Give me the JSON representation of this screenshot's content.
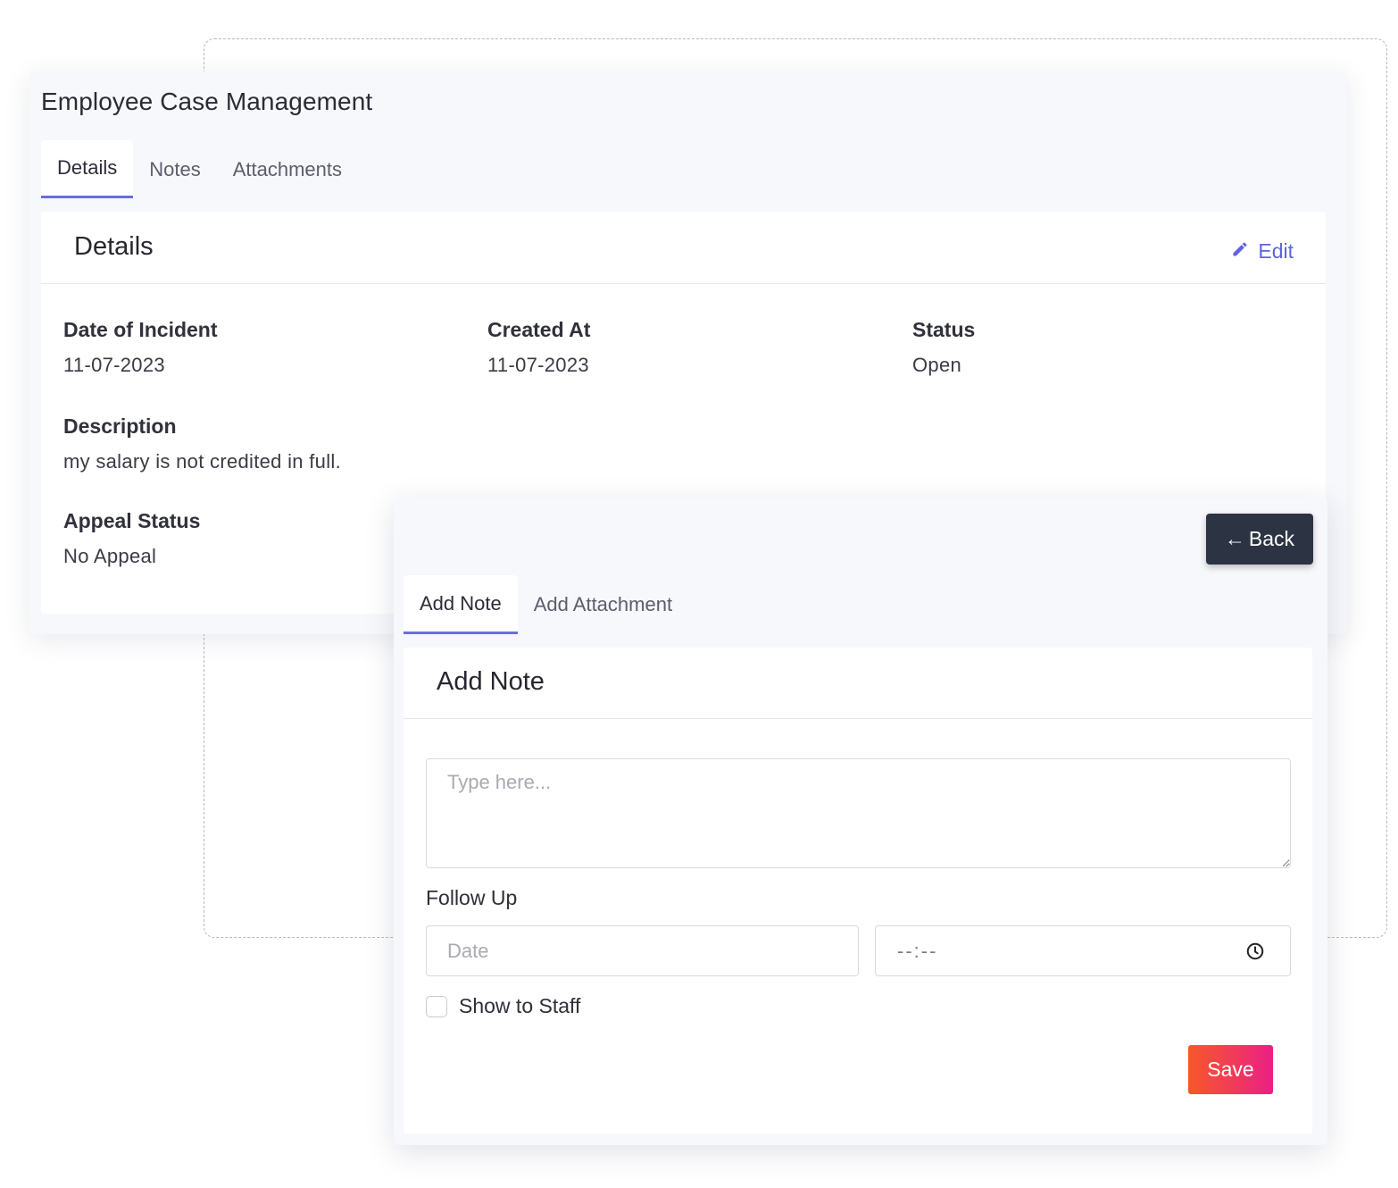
{
  "app": {
    "title": "Employee Case Management"
  },
  "main_tabs": [
    {
      "label": "Details",
      "active": true
    },
    {
      "label": "Notes",
      "active": false
    },
    {
      "label": "Attachments",
      "active": false
    }
  ],
  "details_card": {
    "title": "Details",
    "edit_label": "Edit",
    "fields": {
      "date_of_incident": {
        "label": "Date of Incident",
        "value": "11-07-2023"
      },
      "created_at": {
        "label": "Created At",
        "value": "11-07-2023"
      },
      "status": {
        "label": "Status",
        "value": "Open"
      },
      "description": {
        "label": "Description",
        "value": "my salary is not credited in full."
      },
      "appeal_status": {
        "label": "Appeal Status",
        "value": "No Appeal"
      }
    }
  },
  "overlay": {
    "back_label": "Back",
    "back_arrow": "←",
    "tabs": [
      {
        "label": "Add Note",
        "active": true
      },
      {
        "label": "Add Attachment",
        "active": false
      }
    ],
    "note_card": {
      "title": "Add Note",
      "textarea_placeholder": "Type here...",
      "follow_up_label": "Follow Up",
      "date_placeholder": "Date",
      "time_placeholder": "--:--",
      "show_to_staff_label": "Show to Staff",
      "show_to_staff_checked": false,
      "save_label": "Save"
    }
  },
  "icons": {
    "edit": "pencil-icon",
    "back": "arrow-left-icon",
    "time": "clock-icon"
  },
  "colors": {
    "accent": "#5f62e3",
    "tab_underline": "#6a6ce0",
    "back_button": "#2c3443",
    "save_gradient_start": "#f7582a",
    "save_gradient_end": "#ec1f86",
    "panel_bg": "#f7f8fc"
  }
}
